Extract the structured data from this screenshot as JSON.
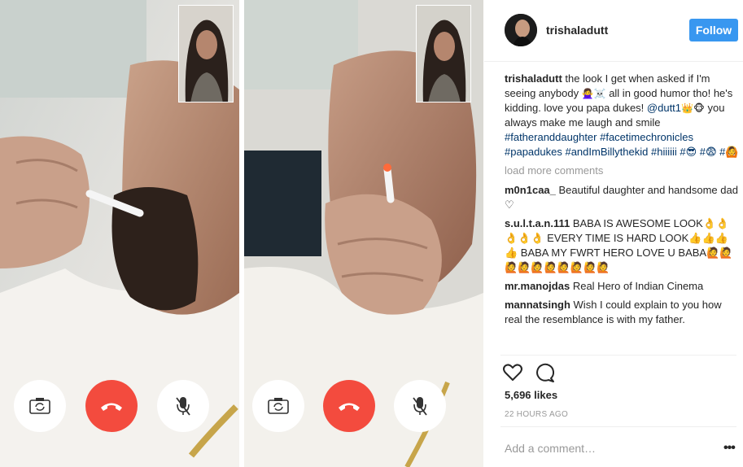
{
  "post": {
    "username": "trishaladutt",
    "follow_label": "Follow",
    "caption_parts": [
      {
        "text": "the look I get when asked if I'm seeing anybody ",
        "type": "text"
      },
      {
        "text": "🙅‍♀️☠️",
        "type": "emoji"
      },
      {
        "text": " all in good humor tho! he's kidding. love you papa dukes! ",
        "type": "text"
      },
      {
        "text": "@dutt1",
        "type": "tag"
      },
      {
        "text": " 👑🐵",
        "type": "emoji"
      },
      {
        "text": " you always make me laugh and smile ",
        "type": "text"
      },
      {
        "text": "#fatheranddaughter",
        "type": "tag"
      },
      {
        "text": " ",
        "type": "text"
      },
      {
        "text": "#facetimechronicles",
        "type": "tag"
      },
      {
        "text": " ",
        "type": "text"
      },
      {
        "text": "#papadukes",
        "type": "tag"
      },
      {
        "text": " ",
        "type": "text"
      },
      {
        "text": "#andImBillythekid",
        "type": "tag"
      },
      {
        "text": " ",
        "type": "text"
      },
      {
        "text": "#hiiiiii",
        "type": "tag"
      },
      {
        "text": " #😎 #😨 #🙆",
        "type": "tag"
      }
    ],
    "load_more": "load more comments",
    "comments": [
      {
        "user": "m0n1caa_",
        "text": "Beautiful daughter and handsome dad ♡"
      },
      {
        "user": "s.u.l.t.a.n.111",
        "text": "BABA IS AWESOME LOOK👌👌👌👌👌 EVERY TIME IS HARD LOOK👍👍👍👍 BABA MY FWRT HERO LOVE U BABA🙋🙋🙋🙋🙋🙋🙋🙋🙋🙋"
      },
      {
        "user": "mr.manojdas",
        "text": "Real Hero of Indian Cinema"
      },
      {
        "user": "mannatsingh",
        "text": "Wish I could explain to you how real the resemblance is with my father."
      }
    ],
    "likes": "5,696 likes",
    "timestamp": "22 HOURS AGO",
    "add_comment_placeholder": "Add a comment…",
    "more_label": "•••"
  },
  "icons": {
    "like": "heart-icon",
    "comment": "comment-bubble-icon",
    "flip_camera": "flip-camera-icon",
    "end_call": "end-call-icon",
    "mute": "mic-off-icon"
  },
  "colors": {
    "follow_bg": "#3897f0",
    "end_call_red": "#f34b3e",
    "hashtag": "#003569",
    "muted_text": "#999999"
  }
}
